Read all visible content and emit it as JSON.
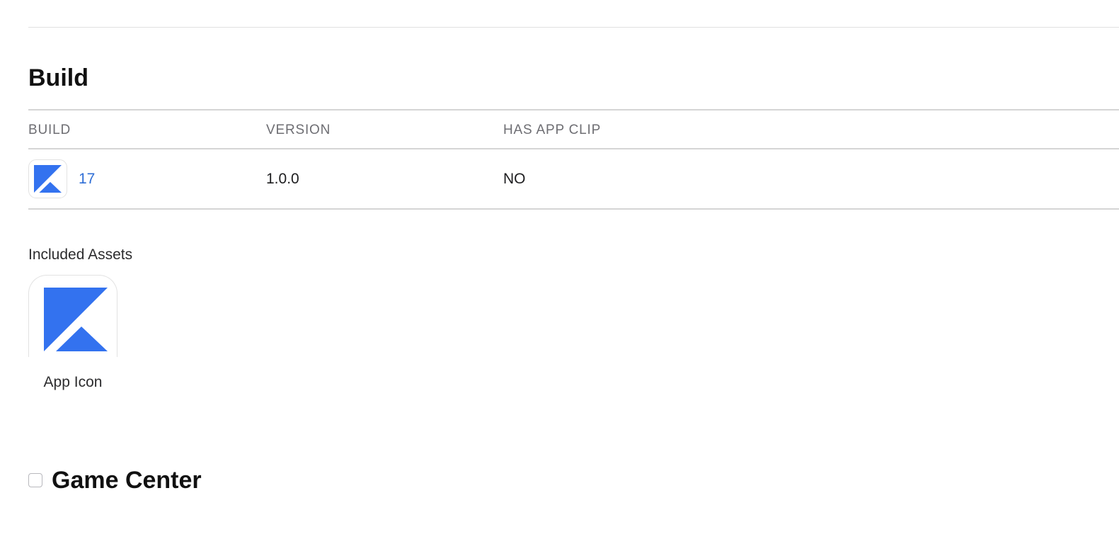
{
  "build_section": {
    "title": "Build",
    "columns": [
      "BUILD",
      "VERSION",
      "HAS APP CLIP"
    ],
    "rows": [
      {
        "build": "17",
        "version": "1.0.0",
        "has_app_clip": "NO"
      }
    ]
  },
  "assets": {
    "label": "Included Assets",
    "items": [
      {
        "caption": "App Icon",
        "icon": "app-icon"
      }
    ]
  },
  "game_center": {
    "title": "Game Center",
    "checked": false
  },
  "colors": {
    "brand_blue": "#3372ef",
    "link_blue": "#2f6ed6"
  }
}
